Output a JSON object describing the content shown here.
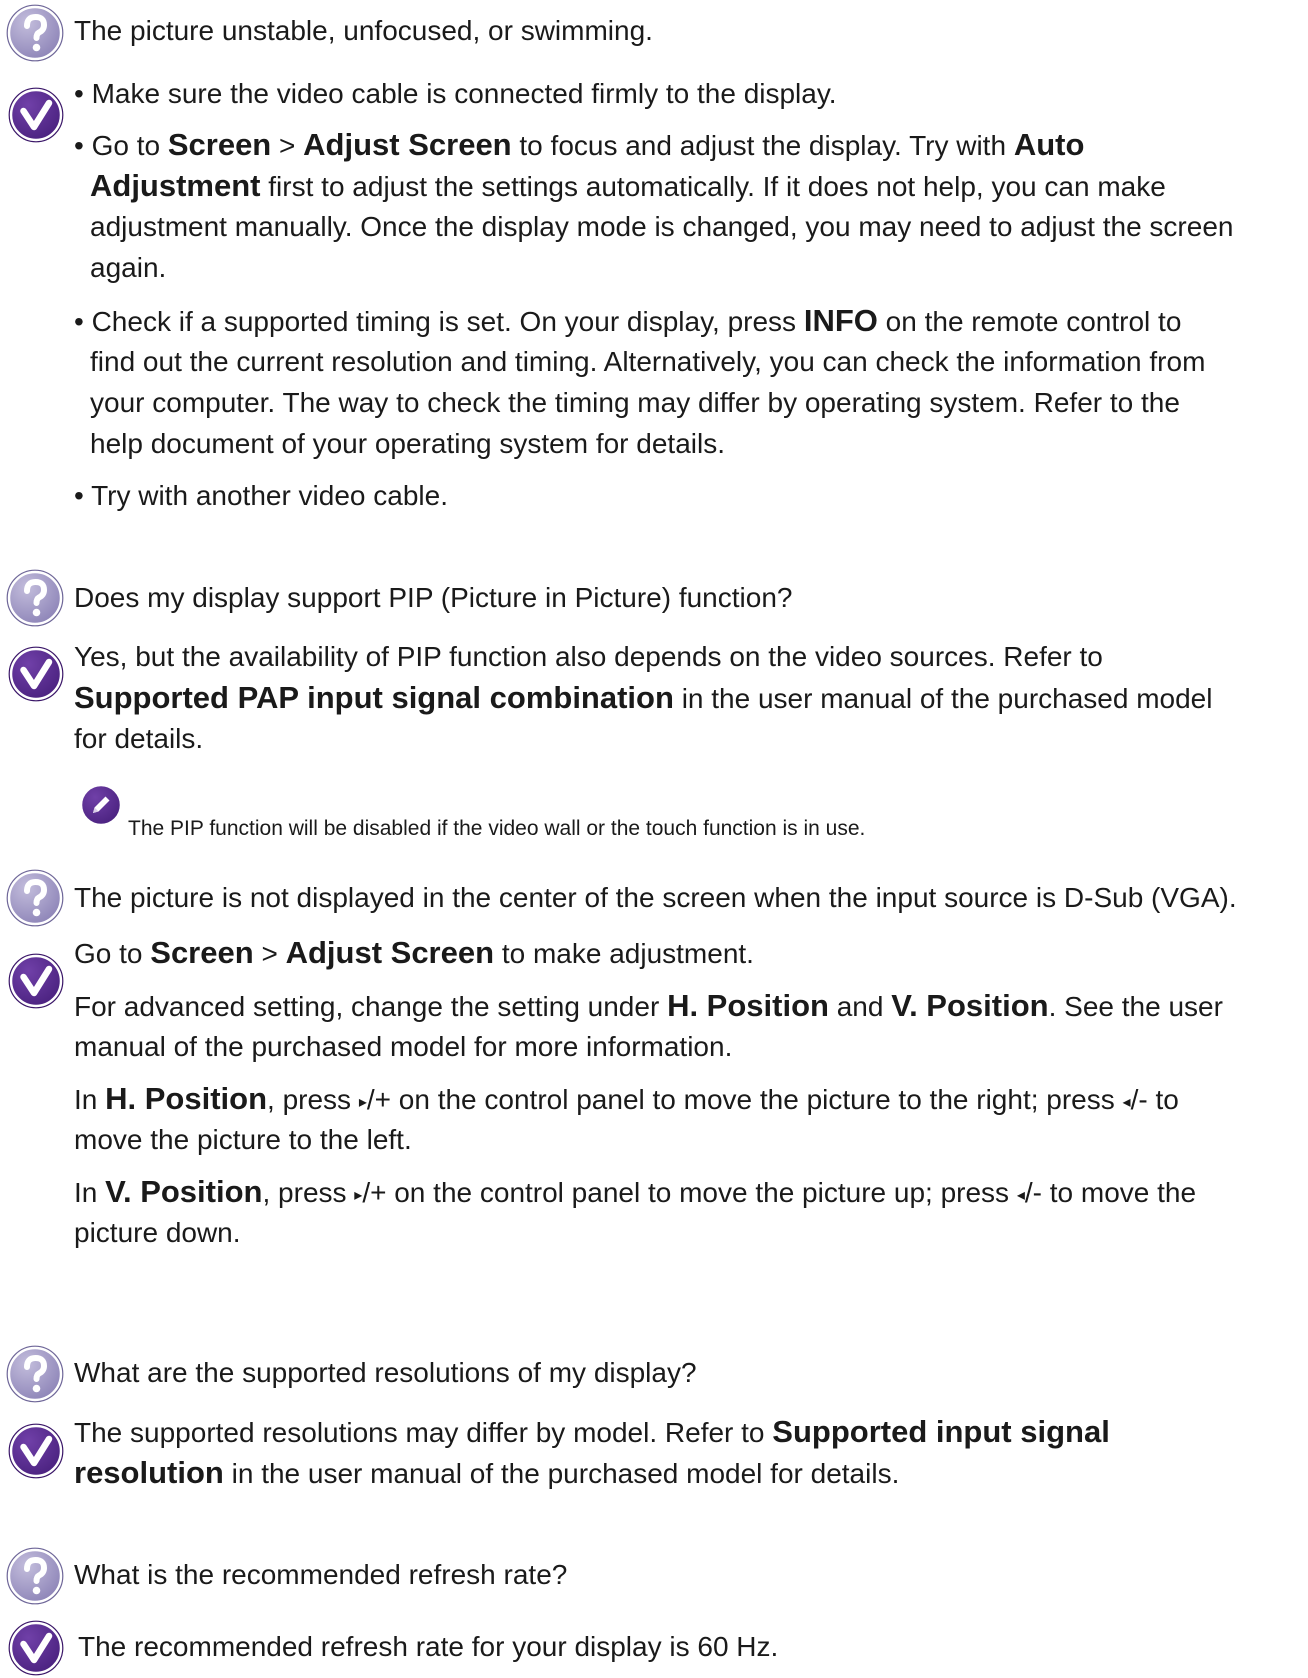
{
  "faq": [
    {
      "question": "The picture unstable, unfocused, or swimming.",
      "answer": {
        "bullet1": "• Make sure the video cable is connected firmly to the display.",
        "bullet2": {
          "line1": {
            "p1": "• Go to ",
            "b1": "Screen",
            "p2": " > ",
            "b2": "Adjust Screen",
            "p3": " to focus and adjust the display. Try with ",
            "b3": "Auto"
          },
          "line2": {
            "b1": "Adjustment",
            "p1": " first to adjust the settings automatically. If it does not help, you can make"
          },
          "line3": "adjustment manually. Once the display mode is changed, you may need to adjust the screen",
          "line4": "again."
        },
        "bullet3": {
          "line1": {
            "p1": "• Check if a supported timing is set. On your display, press ",
            "b1": "INFO",
            "p2": " on the remote control to"
          },
          "line2": "find out the current resolution and timing. Alternatively, you can check the information from",
          "line3": "your computer. The way to check the timing may differ by operating system. Refer to the",
          "line4": "help document of your operating system for details."
        },
        "bullet4": "• Try with another video cable."
      }
    },
    {
      "question": "Does my display support PIP (Picture in Picture) function?",
      "answer": {
        "line1": "Yes, but the availability of PIP function also depends on the video sources. Refer to",
        "line2": {
          "b1": "Supported PAP input signal combination",
          "p1": " in the user manual of the purchased model"
        },
        "line3": "for details.",
        "note": "The PIP function will be disabled if the video wall or the touch function is in use."
      }
    },
    {
      "question": "The picture is not displayed in the center of the screen when the input source is D-Sub (VGA).",
      "answer": {
        "para1": {
          "p1": "Go to ",
          "b1": "Screen",
          "p2": " > ",
          "b2": "Adjust Screen",
          "p3": " to make adjustment."
        },
        "para2": {
          "line1": {
            "p1": "For advanced setting, change the setting under ",
            "b1": "H. Position",
            "p2": " and ",
            "b2": "V. Position",
            "p3": ". See the user"
          },
          "line2": "manual of the purchased model for more information."
        },
        "para3": {
          "line1": {
            "p1": "In ",
            "b1": "H. Position",
            "p2": ", press ",
            "icon1": "▸",
            "p3": "/+ on the control panel to move the picture to the right; press ",
            "icon2": "◂",
            "p4": "/- to"
          },
          "line2": "move the picture to the left."
        },
        "para4": {
          "line1": {
            "p1": "In ",
            "b1": "V. Position",
            "p2": ", press ",
            "icon1": "▸",
            "p3": "/+ on the control panel to move the picture up; press ",
            "icon2": "◂",
            "p4": "/- to move the"
          },
          "line2": "picture down."
        }
      }
    },
    {
      "question": "What are the supported resolutions of my display?",
      "answer": {
        "line1": {
          "p1": "The supported resolutions may differ by model. Refer to ",
          "b1": "Supported input signal"
        },
        "line2": {
          "b1": "resolution",
          "p1": " in the user manual of the purchased model for details."
        }
      }
    },
    {
      "question": "What is the recommended refresh rate?",
      "answer": {
        "line1": "The recommended refresh rate for your display is 60 Hz."
      }
    }
  ],
  "icons": {
    "question": "question-mark-icon",
    "answer": "checkmark-icon",
    "note": "pencil-note-icon"
  },
  "colors": {
    "question_icon": "#a79fc6",
    "answer_icon": "#5a2d91",
    "note_icon": "#5a2d91"
  }
}
